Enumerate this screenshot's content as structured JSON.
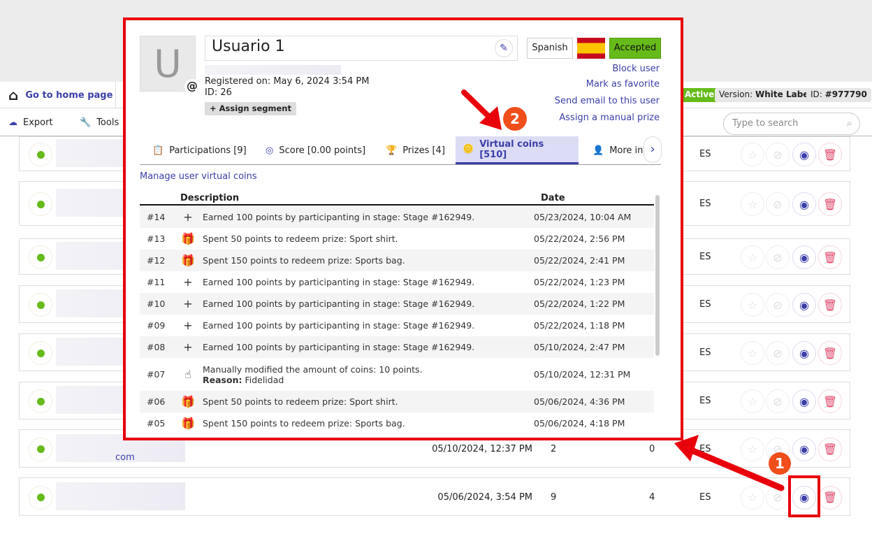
{
  "header": {
    "home_label": "Go to home page",
    "status": "Active",
    "version_label": "Version:",
    "version_value": "White Label",
    "id_label": "ID:",
    "id_value": "#977790"
  },
  "toolbar": {
    "export": "Export",
    "tools": "Tools",
    "search_placeholder": "Type to search"
  },
  "rows": [
    {
      "date": "",
      "participations": "",
      "prizes": "",
      "lang": "ES"
    },
    {
      "date": "",
      "participations": "",
      "prizes": "",
      "lang": "ES"
    },
    {
      "date": "",
      "participations": "",
      "prizes": "",
      "lang": "ES"
    },
    {
      "date": "",
      "participations": "",
      "prizes": "",
      "lang": "ES"
    },
    {
      "date": "",
      "participations": "",
      "prizes": "",
      "lang": "ES"
    },
    {
      "date": "",
      "participations": "",
      "prizes": "",
      "lang": "ES"
    },
    {
      "date": "05/10/2024, 12:37 PM",
      "participations": "2",
      "prizes": "0",
      "lang": "ES",
      "email_suffix": "com"
    },
    {
      "date": "05/06/2024, 3:54 PM",
      "participations": "9",
      "prizes": "4",
      "lang": "ES"
    }
  ],
  "modal": {
    "avatar_letter": "U",
    "name": "Usuario 1",
    "registered": "Registered on: May 6, 2024 3:54 PM",
    "id": "ID: 26",
    "assign_segment": "Assign segment",
    "language": "Spanish",
    "status": "Accepted",
    "links": [
      "Block user",
      "Mark as favorite",
      "Send email to this user",
      "Assign a manual prize"
    ],
    "tabs": [
      {
        "label": "Participations [9]",
        "icon": "clipboard-icon"
      },
      {
        "label": "Score [0.00 points]",
        "icon": "target-icon"
      },
      {
        "label": "Prizes [4]",
        "icon": "trophy-icon"
      },
      {
        "label": "Virtual coins [510]",
        "icon": "coins-icon",
        "active": true
      },
      {
        "label": "More inf",
        "icon": "user-icon"
      }
    ],
    "manage_link": "Manage user virtual coins",
    "columns": {
      "description": "Description",
      "date": "Date"
    },
    "transactions": [
      {
        "n": "#14",
        "icon": "plus",
        "desc": "Earned 100 points by participanting in stage: Stage #162949.",
        "date": "05/23/2024, 10:04 AM"
      },
      {
        "n": "#13",
        "icon": "gift",
        "desc": "Spent 50 points to redeem prize: Sport shirt.",
        "date": "05/22/2024, 2:56 PM"
      },
      {
        "n": "#12",
        "icon": "gift",
        "desc": "Spent 150 points to redeem prize: Sports bag.",
        "date": "05/22/2024, 2:41 PM"
      },
      {
        "n": "#11",
        "icon": "plus",
        "desc": "Earned 100 points by participanting in stage: Stage #162949.",
        "date": "05/22/2024, 1:23 PM"
      },
      {
        "n": "#10",
        "icon": "plus",
        "desc": "Earned 100 points by participanting in stage: Stage #162949.",
        "date": "05/22/2024, 1:22 PM"
      },
      {
        "n": "#09",
        "icon": "plus",
        "desc": "Earned 100 points by participanting in stage: Stage #162949.",
        "date": "05/22/2024, 1:18 PM"
      },
      {
        "n": "#08",
        "icon": "plus",
        "desc": "Earned 100 points by participanting in stage: Stage #162949.",
        "date": "05/10/2024, 2:47 PM"
      },
      {
        "n": "#07",
        "icon": "hand",
        "desc": "Manually modified the amount of coins: 10 points.",
        "reason_label": "Reason:",
        "reason": "Fidelidad",
        "date": "05/10/2024, 12:31 PM"
      },
      {
        "n": "#06",
        "icon": "gift",
        "desc": "Spent 50 points to redeem prize: Sport shirt.",
        "date": "05/06/2024, 4:36 PM"
      },
      {
        "n": "#05",
        "icon": "gift",
        "desc": "Spent 150 points to redeem prize: Sports bag.",
        "date": "05/06/2024, 4:18 PM"
      }
    ]
  },
  "annotations": {
    "step1": "1",
    "step2": "2",
    "color": "#e8000b"
  }
}
